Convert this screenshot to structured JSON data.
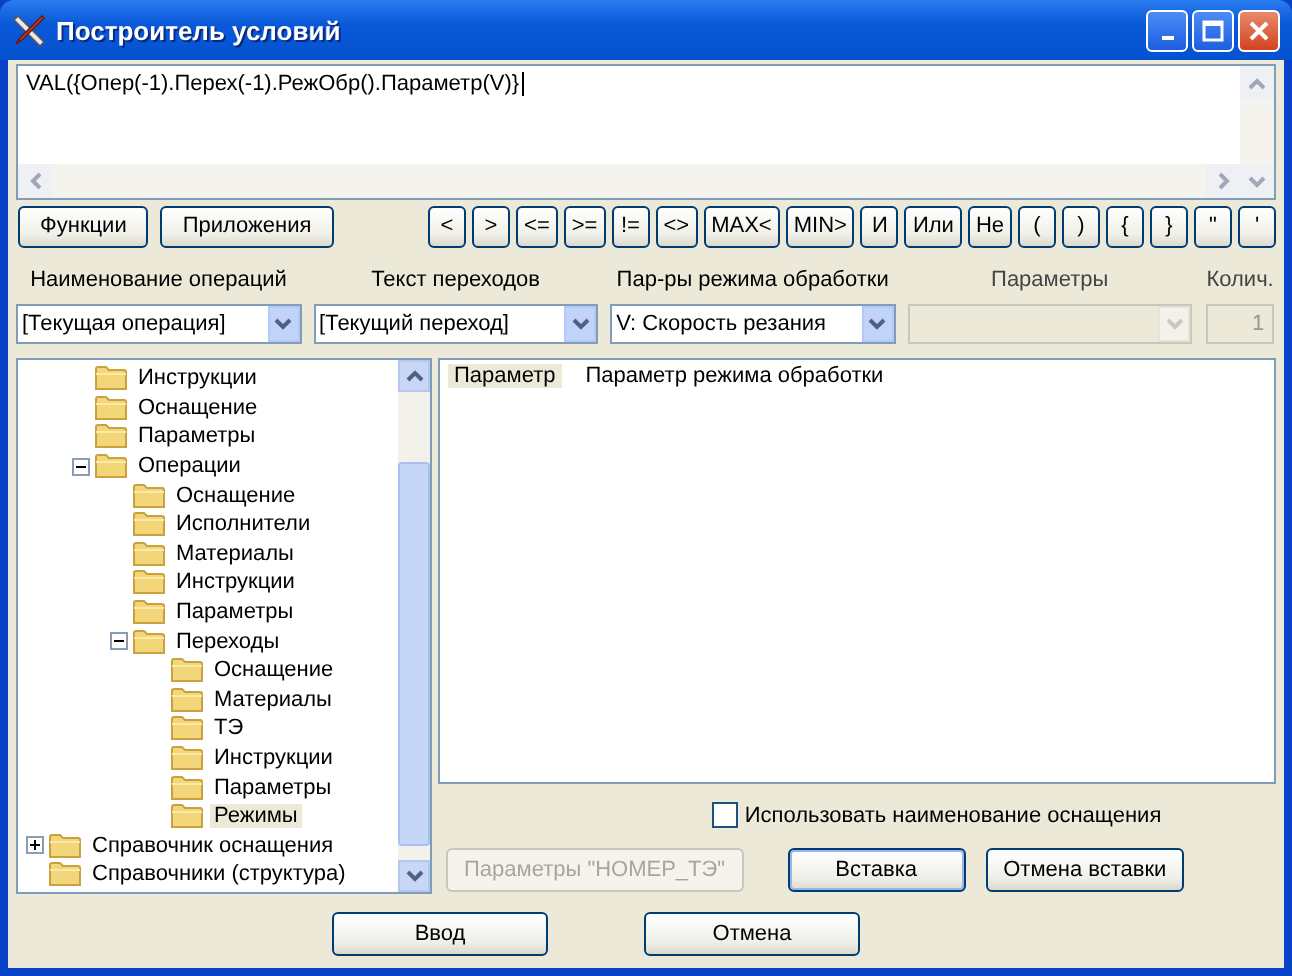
{
  "window": {
    "title": "Построитель условий"
  },
  "expression": {
    "value": "VAL({Опер(-1).Перех(-1).РежОбр().Параметр(V)}"
  },
  "toolbar": {
    "left_buttons": [
      "Функции",
      "Приложения"
    ],
    "operators": [
      "<",
      ">",
      "<=",
      ">=",
      "!=",
      "<>",
      "MAX<",
      "MIN>",
      "И",
      "Или",
      "Не",
      "(",
      ")",
      "{",
      "}",
      "\"",
      "'"
    ]
  },
  "selectors": [
    {
      "label": "Наименование операций",
      "value": "[Текущая операция]",
      "disabled": false,
      "kind": "combo"
    },
    {
      "label": "Текст переходов",
      "value": "[Текущий переход]",
      "disabled": false,
      "kind": "combo"
    },
    {
      "label": "Пар-ры режима обработки",
      "value": "V: Скорость резания",
      "disabled": false,
      "kind": "combo"
    },
    {
      "label": "Параметры",
      "disabled": true,
      "kind": "combo"
    },
    {
      "label": "Колич.",
      "value": "1",
      "disabled": true,
      "kind": "number"
    }
  ],
  "tree": {
    "partial_branch": [
      {
        "label": "Инструкции",
        "selected": false
      },
      {
        "label": "Оснащение",
        "selected": false
      },
      {
        "label": "Параметры",
        "selected": false
      },
      {
        "label": "Операции",
        "selected": false,
        "expanded": true,
        "children": [
          {
            "label": "Оснащение",
            "selected": false
          },
          {
            "label": "Исполнители",
            "selected": false
          },
          {
            "label": "Материалы",
            "selected": false
          },
          {
            "label": "Инструкции",
            "selected": false
          },
          {
            "label": "Параметры",
            "selected": false
          },
          {
            "label": "Переходы",
            "selected": false,
            "expanded": true,
            "children": [
              {
                "label": "Оснащение",
                "selected": false
              },
              {
                "label": "Материалы",
                "selected": false
              },
              {
                "label": "ТЭ",
                "selected": false
              },
              {
                "label": "Инструкции",
                "selected": false
              },
              {
                "label": "Параметры",
                "selected": false
              },
              {
                "label": "Режимы",
                "selected": true
              }
            ]
          }
        ]
      }
    ],
    "items": [
      {
        "label": "Справочник оснащения",
        "selected": false,
        "expanded": false
      },
      {
        "label": "Справочники (структура)",
        "selected": false
      }
    ]
  },
  "details": {
    "name": "Параметр",
    "description": "Параметр режима обработки"
  },
  "use_equipment_name": {
    "label": "Использовать наименование оснащения",
    "checked": false
  },
  "action_buttons": [
    {
      "label": "Параметры \"НОМЕР_ТЭ\"",
      "disabled": true,
      "default": false
    },
    {
      "label": "Вставка",
      "disabled": false,
      "default": true
    },
    {
      "label": "Отмена вставки",
      "disabled": false,
      "default": false
    }
  ],
  "dialog_buttons": [
    "Ввод",
    "Отмена"
  ]
}
